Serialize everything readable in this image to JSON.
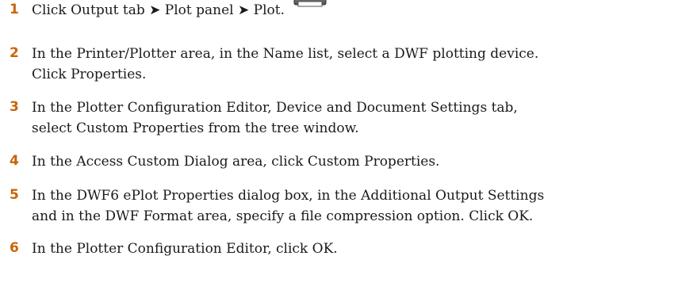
{
  "steps": [
    {
      "number": "1",
      "text": "Click Output tab ➤ Plot panel ➤ Plot.",
      "icon": "plot-icon"
    },
    {
      "number": "2",
      "lines": [
        "In the Printer/Plotter area, in the Name list, select a DWF plotting device.",
        "Click Properties."
      ]
    },
    {
      "number": "3",
      "lines": [
        "In the Plotter Configuration Editor, Device and Document Settings tab,",
        "select Custom Properties from the tree window."
      ]
    },
    {
      "number": "4",
      "lines": [
        "In the Access Custom Dialog area, click Custom Properties."
      ]
    },
    {
      "number": "5",
      "lines": [
        "In the DWF6 ePlot Properties dialog box, in the Additional Output Settings",
        "and in the DWF Format area, specify a file compression option. Click OK."
      ]
    },
    {
      "number": "6",
      "lines": [
        "In the Plotter Configuration Editor, click OK."
      ]
    }
  ]
}
